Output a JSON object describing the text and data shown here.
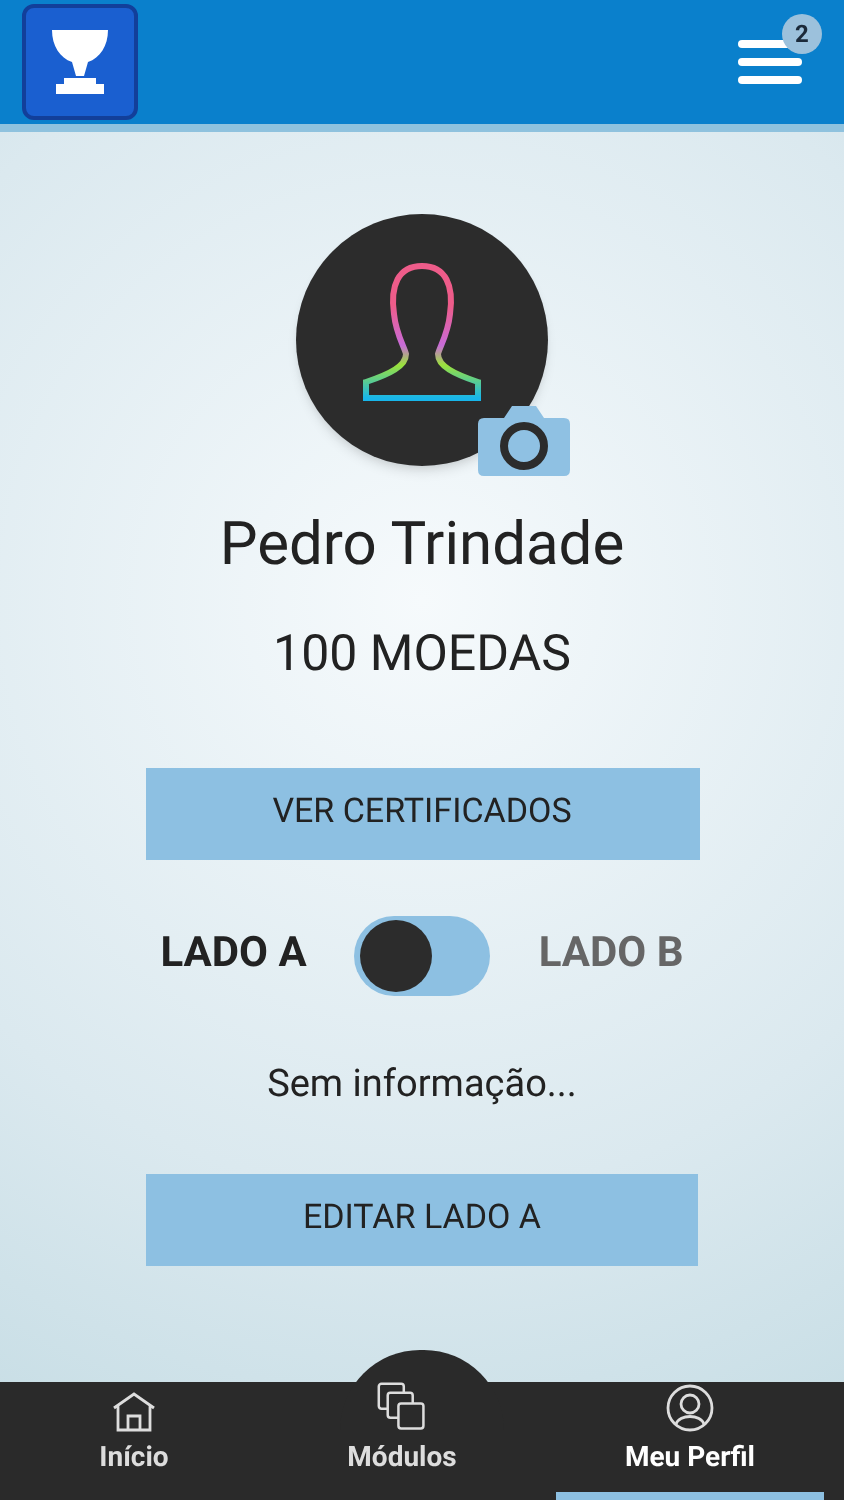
{
  "header": {
    "notification_count": "2"
  },
  "profile": {
    "name": "Pedro Trindade",
    "coins": "100 MOEDAS"
  },
  "certificates_button": "VER CERTIFICADOS",
  "side_toggle": {
    "left_label": "LADO A",
    "right_label": "LADO B",
    "on": false
  },
  "info_text": "Sem informação...",
  "edit_button": "EDITAR LADO A",
  "tabs": [
    {
      "label": "Início",
      "kind": "home",
      "selected": false
    },
    {
      "label": "Módulos",
      "kind": "modules",
      "selected": false
    },
    {
      "label": "Meu Perfil",
      "kind": "profile",
      "selected": true
    }
  ]
}
